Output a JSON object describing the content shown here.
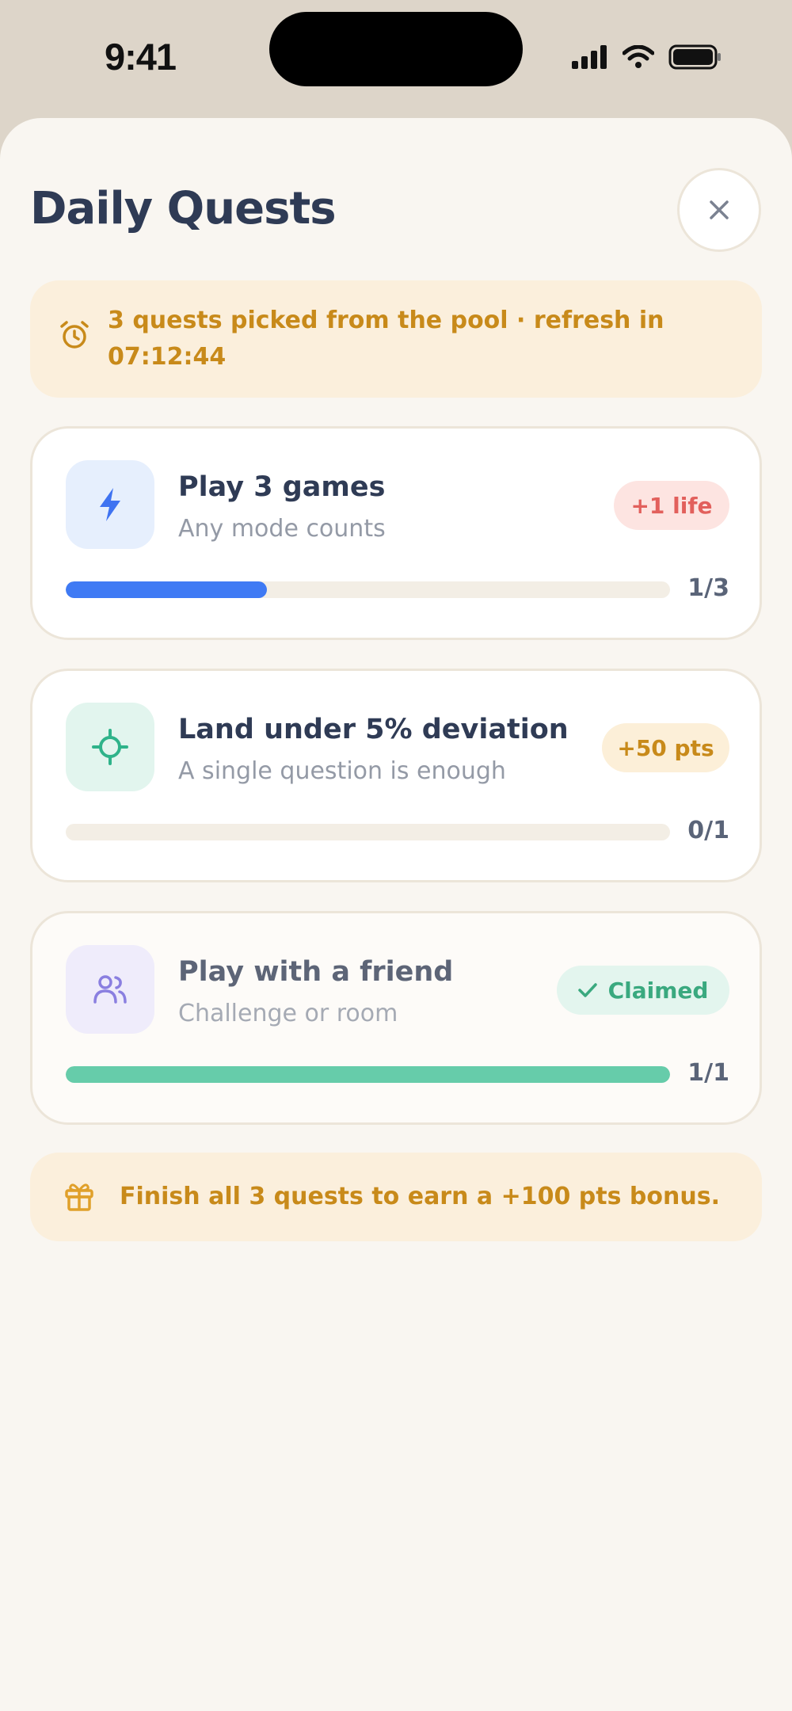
{
  "status_bar": {
    "time": "9:41"
  },
  "sheet": {
    "title": "Daily Quests"
  },
  "refresh_banner": {
    "text": "3 quests picked from the pool · refresh in 07:12:44",
    "icon": "alarm-clock-icon"
  },
  "quests": [
    {
      "title": "Play 3 games",
      "subtitle": "Any mode counts",
      "reward": "+1 life",
      "progress": 0.333,
      "count": "1/3",
      "icon": "lightning-icon",
      "icon_color": "#3f73f1",
      "icon_bg": "#e6effd",
      "bar_color": "#3f7af4",
      "reward_color": "#e2605c",
      "reward_bg": "#fde4e1",
      "claimed": false
    },
    {
      "title": "Land under 5% deviation",
      "subtitle": "A single question is enough",
      "reward": "+50 pts",
      "progress": 0,
      "count": "0/1",
      "icon": "crosshair-icon",
      "icon_color": "#2fb38a",
      "icon_bg": "#e2f5ee",
      "bar_color": "#66ccaa",
      "reward_color": "#c88a1a",
      "reward_bg": "#fcefd8",
      "claimed": false
    },
    {
      "title": "Play with a friend",
      "subtitle": "Challenge or room",
      "reward": "Claimed",
      "progress": 1,
      "count": "1/1",
      "icon": "users-icon",
      "icon_color": "#8a7fe0",
      "icon_bg": "#efecfb",
      "bar_color": "#66ccaa",
      "reward_color": "#3aa97f",
      "reward_bg": "#e3f5ee",
      "claimed": true
    }
  ],
  "bonus_banner": {
    "text": "Finish all 3 quests to earn a +100 pts bonus.",
    "icon": "gift-icon"
  },
  "colors": {
    "accent_amber": "#c88a1a",
    "title": "#2f3b55",
    "sheet_bg": "#f9f6f1"
  }
}
